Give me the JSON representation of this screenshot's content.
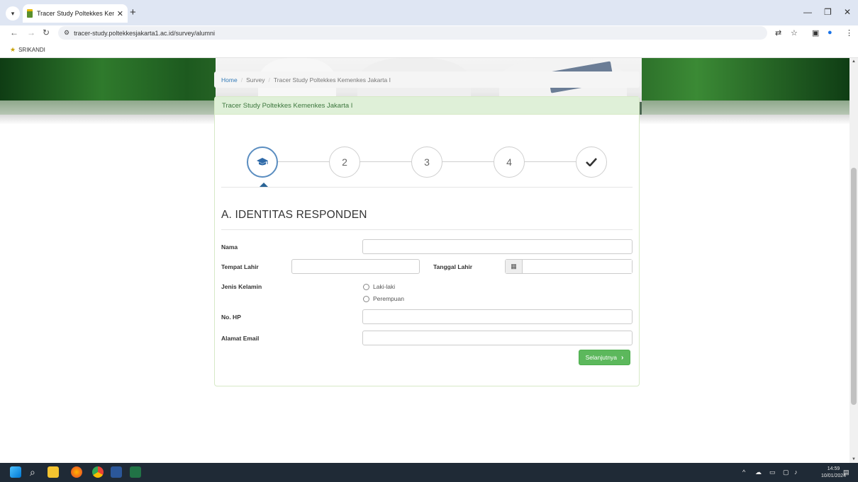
{
  "browser": {
    "tab_title": "Tracer Study Poltekkes Kemenk",
    "url": "tracer-study.poltekkesjakarta1.ac.id/survey/alumni",
    "bookmark": "SRIKANDI",
    "icons": [
      "tab-list-icon",
      "close-icon",
      "new-tab-icon",
      "minimize-icon",
      "restore-icon",
      "back-icon",
      "forward-icon",
      "reload-icon",
      "site-info-icon",
      "translate-icon",
      "star-icon",
      "sidebar-icon",
      "profile-icon",
      "menu-icon"
    ]
  },
  "breadcrumb": {
    "home": "Home",
    "survey": "Survey",
    "current": "Tracer Study Poltekkes Kemenkes Jakarta I"
  },
  "panel": {
    "title": "Tracer Study Poltekkes Kemenkes Jakarta I"
  },
  "wizard": {
    "steps": [
      "",
      "2",
      "3",
      "4",
      ""
    ],
    "active_step": 1,
    "icons": [
      "graduation-cap-icon",
      "check-icon"
    ]
  },
  "form": {
    "section_title": "A. IDENTITAS RESPONDEN",
    "nama_label": "Nama",
    "nama_value": "",
    "tempat_lahir_label": "Tempat Lahir",
    "tempat_lahir_value": "",
    "tanggal_lahir_label": "Tanggal Lahir",
    "tanggal_lahir_value": "",
    "jenis_kelamin_label": "Jenis Kelamin",
    "gender_options": [
      "Laki-laki",
      "Perempuan"
    ],
    "no_hp_label": "No. HP",
    "no_hp_value": "",
    "email_label": "Alamat Email",
    "email_value": "",
    "next_button": "Selanjutnya"
  },
  "taskbar": {
    "time": "14:59",
    "date": "10/01/2024"
  },
  "colors": {
    "panel_header_bg": "#dff0d8",
    "panel_header_text": "#3c763d",
    "link": "#337ab7",
    "button_success": "#5cb85c",
    "banner_green": "#2e6b2a"
  }
}
